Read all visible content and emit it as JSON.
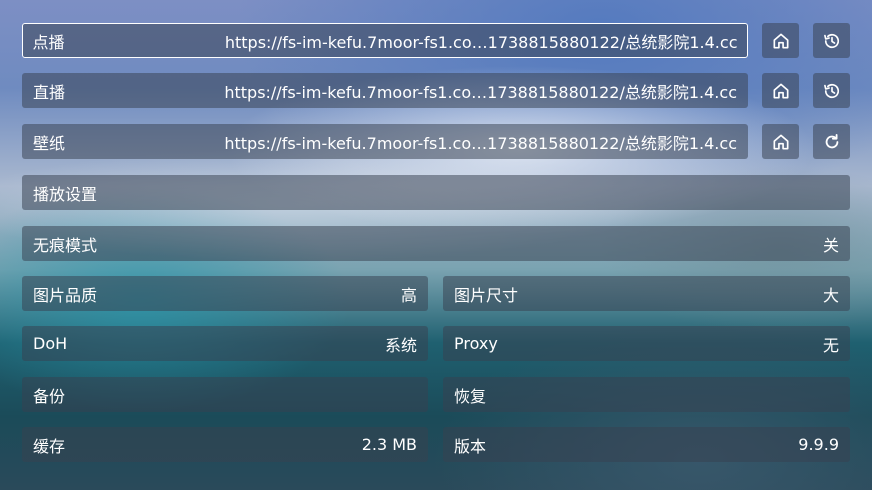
{
  "sources": {
    "vod": {
      "label": "点播",
      "value": "https://fs-im-kefu.7moor-fs1.co…1738815880122/总统影院1.4.cc"
    },
    "live": {
      "label": "直播",
      "value": "https://fs-im-kefu.7moor-fs1.co…1738815880122/总统影院1.4.cc"
    },
    "wallpaper": {
      "label": "壁纸",
      "value": "https://fs-im-kefu.7moor-fs1.co…1738815880122/总统影院1.4.cc"
    }
  },
  "icons": {
    "home": "home-icon",
    "history": "history-icon",
    "refresh": "refresh-icon"
  },
  "settings": {
    "playback": {
      "label": "播放设置"
    },
    "incognito": {
      "label": "无痕模式",
      "value": "关"
    },
    "image_quality": {
      "label": "图片品质",
      "value": "高"
    },
    "image_size": {
      "label": "图片尺寸",
      "value": "大"
    },
    "doh": {
      "label": "DoH",
      "value": "系统"
    },
    "proxy": {
      "label": "Proxy",
      "value": "无"
    },
    "backup": {
      "label": "备份"
    },
    "restore": {
      "label": "恢复"
    },
    "cache": {
      "label": "缓存",
      "value": "2.3 MB"
    },
    "version": {
      "label": "版本",
      "value": "9.9.9"
    }
  }
}
